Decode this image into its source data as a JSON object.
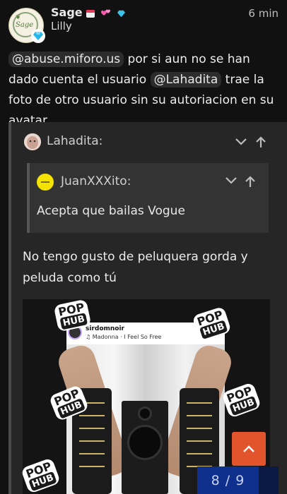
{
  "post": {
    "author_name": "Sage",
    "author_subname": "Lilly",
    "time": "6 min",
    "avatar_text": "Sage",
    "mention1": "@abuse.miforo.us",
    "text1": " por si aun no se han dado cuenta el usuario ",
    "mention2": "@Lahadita",
    "text2": " trae la foto de otro usuario sin su autoriacion en su avatar"
  },
  "quote": {
    "author": "Lahadita:",
    "inner_author": "JuanXXXito:",
    "inner_text": "Acepta que bailas Vogue",
    "reply_text": "No tengo gusto de peluquera gorda y peluda como tú"
  },
  "image": {
    "watermark_top": "POP",
    "watermark_bottom": "HUB",
    "card_user": "sirdomnoir",
    "card_song": "Madonna · I Feel So Free",
    "card_menu": "···"
  },
  "icons": {
    "collapse": "chevron-down-icon",
    "goto": "arrow-up-icon",
    "scroll_top": "chevron-up-icon"
  },
  "pager": {
    "text": "8 / 9"
  },
  "colors": {
    "accent": "#e2552c",
    "pager": "#0e2f8c",
    "background": "#111111"
  }
}
